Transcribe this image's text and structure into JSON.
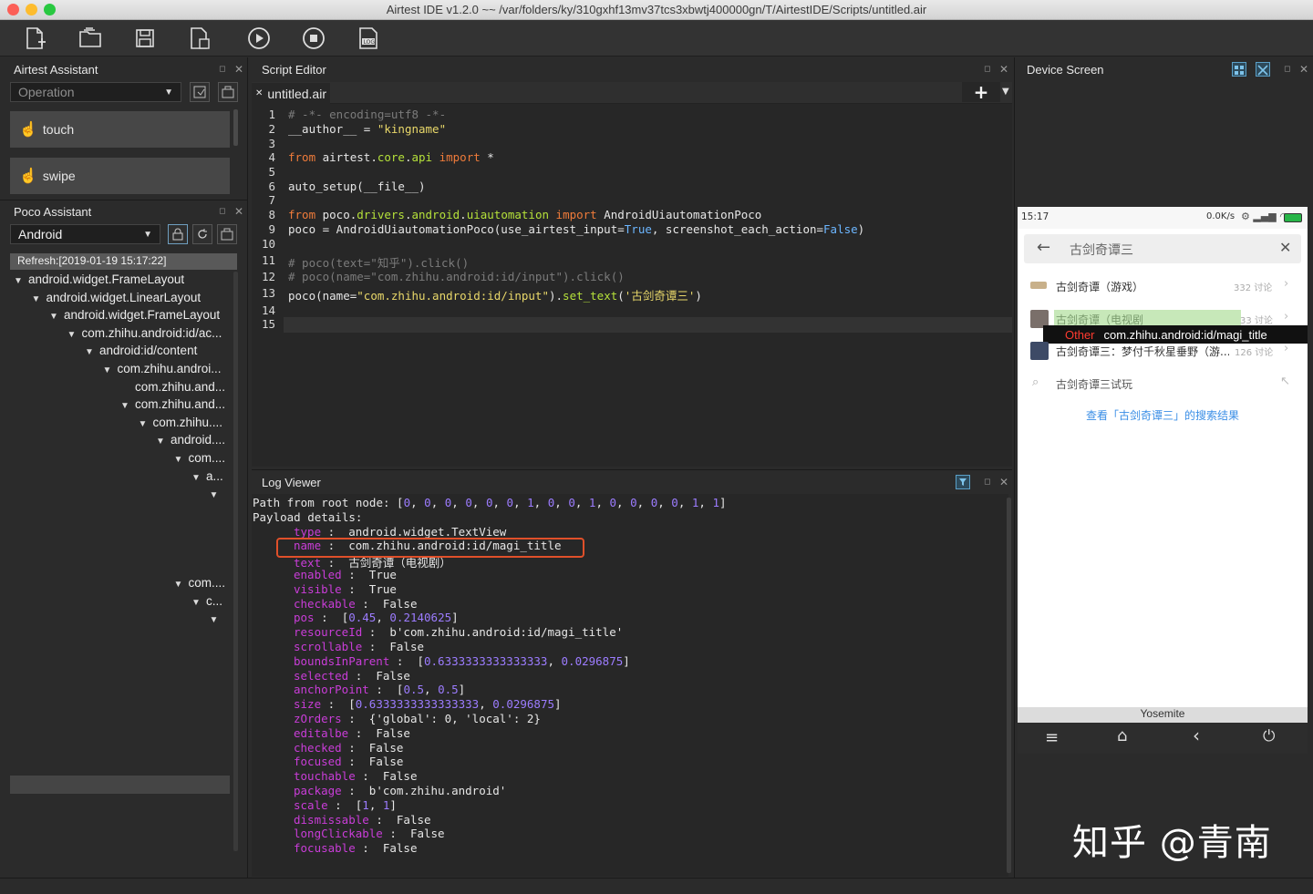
{
  "window": {
    "title": "Airtest IDE v1.2.0 ~~ /var/folders/ky/310gxhf13mv37tcs3xbwtj400000gn/T/AirtestIDE/Scripts/untitled.air"
  },
  "airtest_assistant": {
    "title": "Airtest Assistant",
    "dropdown": "Operation",
    "buttons": [
      "touch",
      "swipe"
    ]
  },
  "poco_assistant": {
    "title": "Poco Assistant",
    "dropdown": "Android",
    "refresh": "Refresh:[2019-01-19 15:17:22]",
    "tree": [
      {
        "label": "android.widget.FrameLayout",
        "depth": 0,
        "expanded": true,
        "row": 0
      },
      {
        "label": "android.widget.LinearLayout",
        "depth": 1,
        "expanded": true,
        "row": 1
      },
      {
        "label": "android.widget.FrameLayout",
        "depth": 2,
        "expanded": true,
        "row": 2
      },
      {
        "label": "com.zhihu.android:id/ac...",
        "depth": 3,
        "expanded": true,
        "row": 3
      },
      {
        "label": "android:id/content",
        "depth": 4,
        "expanded": true,
        "row": 4
      },
      {
        "label": "com.zhihu.androi...",
        "depth": 5,
        "expanded": true,
        "row": 5
      },
      {
        "label": "com.zhihu.and...",
        "depth": 6,
        "expanded": null,
        "row": 6
      },
      {
        "label": "com.zhihu.and...",
        "depth": 6,
        "expanded": true,
        "row": 7
      },
      {
        "label": "com.zhihu....",
        "depth": 7,
        "expanded": true,
        "row": 8
      },
      {
        "label": "android....",
        "depth": 8,
        "expanded": true,
        "row": 9
      },
      {
        "label": "com....",
        "depth": 9,
        "expanded": true,
        "row": 10
      },
      {
        "label": "a...",
        "depth": 10,
        "expanded": true,
        "row": 11
      },
      {
        "label": "",
        "depth": 11,
        "expanded": true,
        "row": 12
      },
      {
        "label": "com....",
        "depth": 9,
        "expanded": true,
        "row": 17
      },
      {
        "label": "c...",
        "depth": 10,
        "expanded": true,
        "row": 18
      },
      {
        "label": "",
        "depth": 11,
        "expanded": true,
        "row": 19
      }
    ]
  },
  "script_editor": {
    "title": "Script Editor",
    "tab": "untitled.air",
    "line_numbers": [
      "1",
      "2",
      "3",
      "4",
      "5",
      "6",
      "7",
      "8",
      "9",
      "10",
      "11",
      "12",
      "13",
      "14",
      "15"
    ],
    "lines": [
      [
        {
          "t": "# -*- encoding=utf8 -*-",
          "c": "cm"
        }
      ],
      [
        {
          "t": "__author__ = ",
          "c": ""
        },
        {
          "t": "\"kingname\"",
          "c": "st"
        }
      ],
      [],
      [
        {
          "t": "from",
          "c": "kw"
        },
        {
          "t": " airtest.",
          "c": ""
        },
        {
          "t": "core",
          "c": "fn"
        },
        {
          "t": ".",
          "c": ""
        },
        {
          "t": "api",
          "c": "fn"
        },
        {
          "t": " ",
          "c": ""
        },
        {
          "t": "import",
          "c": "kw"
        },
        {
          "t": " *",
          "c": ""
        }
      ],
      [],
      [
        {
          "t": "auto_setup(__file__)",
          "c": ""
        }
      ],
      [],
      [
        {
          "t": "from",
          "c": "kw"
        },
        {
          "t": " poco.",
          "c": ""
        },
        {
          "t": "drivers",
          "c": "fn"
        },
        {
          "t": ".",
          "c": ""
        },
        {
          "t": "android",
          "c": "fn"
        },
        {
          "t": ".",
          "c": ""
        },
        {
          "t": "uiautomation",
          "c": "fn"
        },
        {
          "t": " ",
          "c": ""
        },
        {
          "t": "import",
          "c": "kw"
        },
        {
          "t": " AndroidUiautomationPoco",
          "c": ""
        }
      ],
      [
        {
          "t": "poco = AndroidUiautomationPoco(use_airtest_input=",
          "c": ""
        },
        {
          "t": "True",
          "c": "bl"
        },
        {
          "t": ", screenshot_each_action=",
          "c": ""
        },
        {
          "t": "False",
          "c": "bl"
        },
        {
          "t": ")",
          "c": ""
        }
      ],
      [],
      [
        {
          "t": "# poco(text=\"知乎\").click()",
          "c": "cm"
        }
      ],
      [
        {
          "t": "# poco(name=\"com.zhihu.android:id/input\").click()",
          "c": "cm"
        }
      ],
      [
        {
          "t": "poco(name=",
          "c": ""
        },
        {
          "t": "\"com.zhihu.android:id/input\"",
          "c": "st"
        },
        {
          "t": ").",
          "c": ""
        },
        {
          "t": "set_text",
          "c": "fn"
        },
        {
          "t": "(",
          "c": ""
        },
        {
          "t": "'古剑奇谭三'",
          "c": "st"
        },
        {
          "t": ")",
          "c": ""
        }
      ],
      [],
      []
    ]
  },
  "log_viewer": {
    "title": "Log Viewer",
    "path_label": "Path from root node: [",
    "path_values": [
      "0",
      "0",
      "0",
      "0",
      "0",
      "0",
      "1",
      "0",
      "0",
      "1",
      "0",
      "0",
      "0",
      "0",
      "1",
      "1"
    ],
    "payload_label": "Payload details:",
    "fields": [
      {
        "k": "type",
        "v": "android.widget.TextView"
      },
      {
        "k": "name",
        "v": "com.zhihu.android:id/magi_title"
      },
      {
        "k": "text",
        "v": "古剑奇谭（电视剧）"
      },
      {
        "k": "enabled",
        "v": "True"
      },
      {
        "k": "visible",
        "v": "True"
      },
      {
        "k": "checkable",
        "v": "False"
      },
      {
        "k": "pos",
        "v": "[0.45, 0.2140625]"
      },
      {
        "k": "resourceId",
        "v": "b'com.zhihu.android:id/magi_title'"
      },
      {
        "k": "scrollable",
        "v": "False"
      },
      {
        "k": "boundsInParent",
        "v": "[0.6333333333333333, 0.0296875]"
      },
      {
        "k": "selected",
        "v": "False"
      },
      {
        "k": "anchorPoint",
        "v": "[0.5, 0.5]"
      },
      {
        "k": "size",
        "v": "[0.6333333333333333, 0.0296875]"
      },
      {
        "k": "zOrders",
        "v": "{'global': 0, 'local': 2}"
      },
      {
        "k": "editalbe",
        "v": "False"
      },
      {
        "k": "checked",
        "v": "False"
      },
      {
        "k": "focused",
        "v": "False"
      },
      {
        "k": "touchable",
        "v": "False"
      },
      {
        "k": "package",
        "v": "b'com.zhihu.android'"
      },
      {
        "k": "scale",
        "v": "[1, 1]"
      },
      {
        "k": "dismissable",
        "v": "False"
      },
      {
        "k": "longClickable",
        "v": "False"
      },
      {
        "k": "focusable",
        "v": "False"
      }
    ],
    "highlight_color": "#e0502a"
  },
  "device_screen": {
    "title": "Device Screen",
    "status_time": "15:17",
    "status_net": "0.0K/s",
    "search_text": "古剑奇谭三",
    "results": [
      {
        "title": "古剑奇谭（游戏）",
        "meta": "332 讨论"
      },
      {
        "title": "古剑奇谭（电视剧",
        "meta": "33 讨论"
      },
      {
        "title": "古剑奇谭三：梦付千秋星垂野（游...",
        "meta": "126 讨论"
      }
    ],
    "suggestion": "古剑奇谭三试玩",
    "search_all": "查看「古剑奇谭三」的搜索结果",
    "tooltip_tag": "Other",
    "tooltip_name": "com.zhihu.android:id/magi_title",
    "device_name": "Yosemite"
  },
  "watermark": "知乎 @青南"
}
